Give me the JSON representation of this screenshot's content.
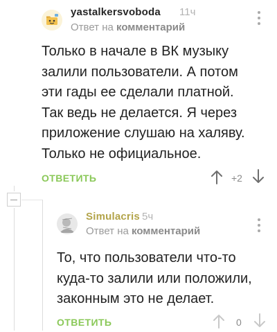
{
  "colors": {
    "accent_green": "#8ac858",
    "text_primary": "#222222",
    "text_muted": "#9a9a9a"
  },
  "comments": [
    {
      "username": "yastalkersvoboda",
      "time": "11ч",
      "reply_prefix": "Ответ на",
      "reply_target": "комментарий",
      "avatar_icon": "folder-cartoon-avatar-icon",
      "text_lines": [
        "Только в начале в ВК музыку",
        "залили пользователи. А потом",
        "эти гады ее сделали платной.",
        "Так ведь не делается. Я через",
        "приложение слушаю на халяву.",
        "Только не официальное."
      ],
      "reply_label": "ОТВЕТИТЬ",
      "rating": "+2"
    },
    {
      "username": "Simulacris",
      "time": "5ч",
      "reply_prefix": "Ответ на",
      "reply_target": "комментарий",
      "avatar_icon": "grey-sketch-avatar-icon",
      "text_lines": [
        "То, что пользователи что-то",
        "куда-то залили или положили,",
        "законным это не делает."
      ],
      "reply_label": "ОТВЕТИТЬ",
      "rating": "0"
    }
  ]
}
